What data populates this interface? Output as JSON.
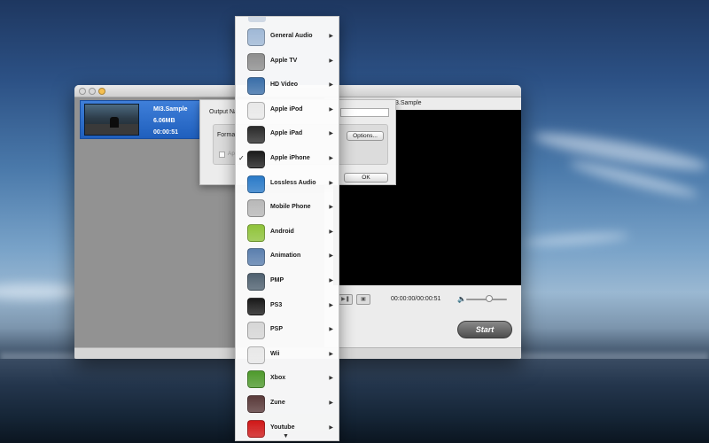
{
  "window": {
    "file_name": "MI3.Sample",
    "file_size": "6.06MB",
    "file_duration": "00:00:51",
    "preview_title": "3.Sample",
    "timecode": "00:00:00/00:00:51",
    "start_label": "Start"
  },
  "sheet": {
    "output_label": "Output Na",
    "format_label": "Format",
    "options_label": "Options...",
    "apply_label": "App",
    "ok_label": "OK"
  },
  "menu": {
    "items": [
      {
        "label": "General Audio",
        "icon": "music-note-icon",
        "color": "#9fb8d6"
      },
      {
        "label": "Apple TV",
        "icon": "apple-tv-icon",
        "color": "#8e8e8e"
      },
      {
        "label": "HD Video",
        "icon": "hd-video-icon",
        "color": "#3a6ea8"
      },
      {
        "label": "Apple iPod",
        "icon": "ipod-icon",
        "color": "#e8e8e8"
      },
      {
        "label": "Apple iPad",
        "icon": "ipad-icon",
        "color": "#2b2b2b"
      },
      {
        "label": "Apple iPhone",
        "icon": "iphone-icon",
        "color": "#1c1c1c",
        "checked": true
      },
      {
        "label": "Lossless Audio",
        "icon": "lossless-audio-icon",
        "color": "#2a7ac8"
      },
      {
        "label": "Mobile Phone",
        "icon": "mobile-phone-icon",
        "color": "#b8b8b8"
      },
      {
        "label": "Android",
        "icon": "android-icon",
        "color": "#8fc33a"
      },
      {
        "label": "Animation",
        "icon": "film-strip-icon",
        "color": "#5b7fae"
      },
      {
        "label": "PMP",
        "icon": "pmp-icon",
        "color": "#4f6170"
      },
      {
        "label": "PS3",
        "icon": "ps3-icon",
        "color": "#1a1a1a"
      },
      {
        "label": "PSP",
        "icon": "psp-icon",
        "color": "#d6d6d6"
      },
      {
        "label": "Wii",
        "icon": "wii-icon",
        "color": "#e8e8e8"
      },
      {
        "label": "Xbox",
        "icon": "xbox-icon",
        "color": "#4e9a2c"
      },
      {
        "label": "Zune",
        "icon": "zune-icon",
        "color": "#5a3a3a"
      },
      {
        "label": "Youtube",
        "icon": "youtube-icon",
        "color": "#d01818"
      }
    ]
  }
}
